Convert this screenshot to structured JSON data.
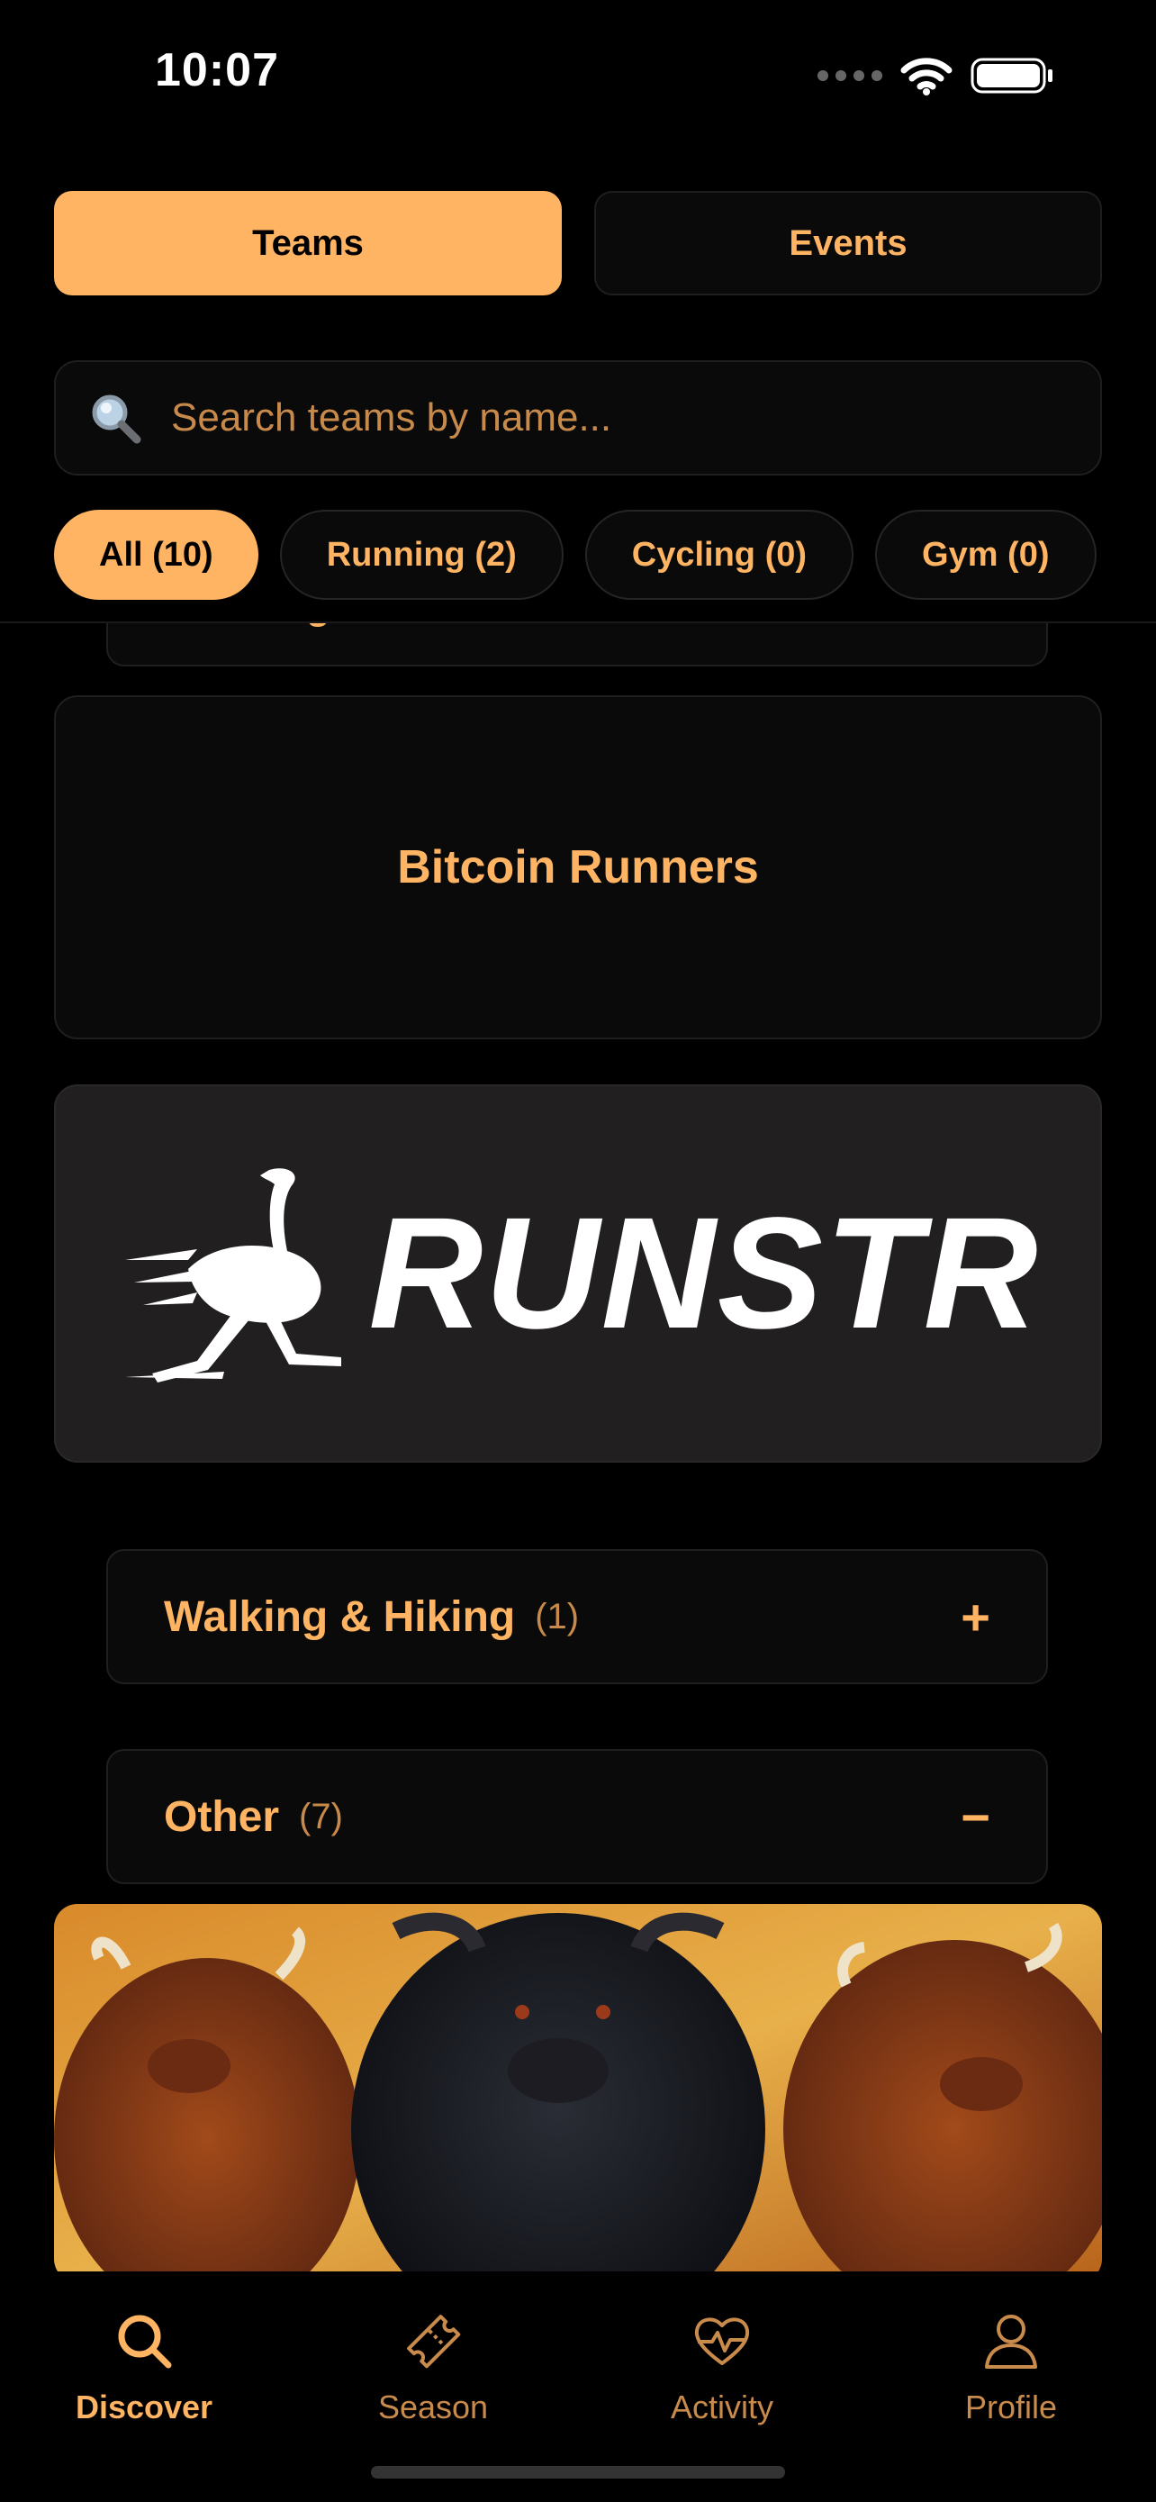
{
  "status_bar": {
    "time": "10:07"
  },
  "segments": {
    "teams_label": "Teams",
    "events_label": "Events"
  },
  "search": {
    "placeholder": "Search teams by name..."
  },
  "filters": [
    {
      "label": "All (10)",
      "active": true
    },
    {
      "label": "Running (2)",
      "active": false
    },
    {
      "label": "Cycling (0)",
      "active": false
    },
    {
      "label": "Gym (0)",
      "active": false
    }
  ],
  "list": {
    "team_name": "Bitcoin Runners",
    "runstr_logo_text": "RUNSTR",
    "categories": [
      {
        "title": "Walking & Hiking",
        "count": "(1)",
        "toggle": "+"
      },
      {
        "title": "Other",
        "count": "(7)",
        "toggle": "−"
      }
    ]
  },
  "tabbar": {
    "items": [
      {
        "label": "Discover",
        "icon": "search-icon",
        "active": true
      },
      {
        "label": "Season",
        "icon": "ticket-icon",
        "active": false
      },
      {
        "label": "Activity",
        "icon": "heart-pulse-icon",
        "active": false
      },
      {
        "label": "Profile",
        "icon": "person-icon",
        "active": false
      }
    ]
  },
  "colors": {
    "accent": "#FFB463",
    "background": "#000000",
    "card": "#0A0A0A"
  }
}
